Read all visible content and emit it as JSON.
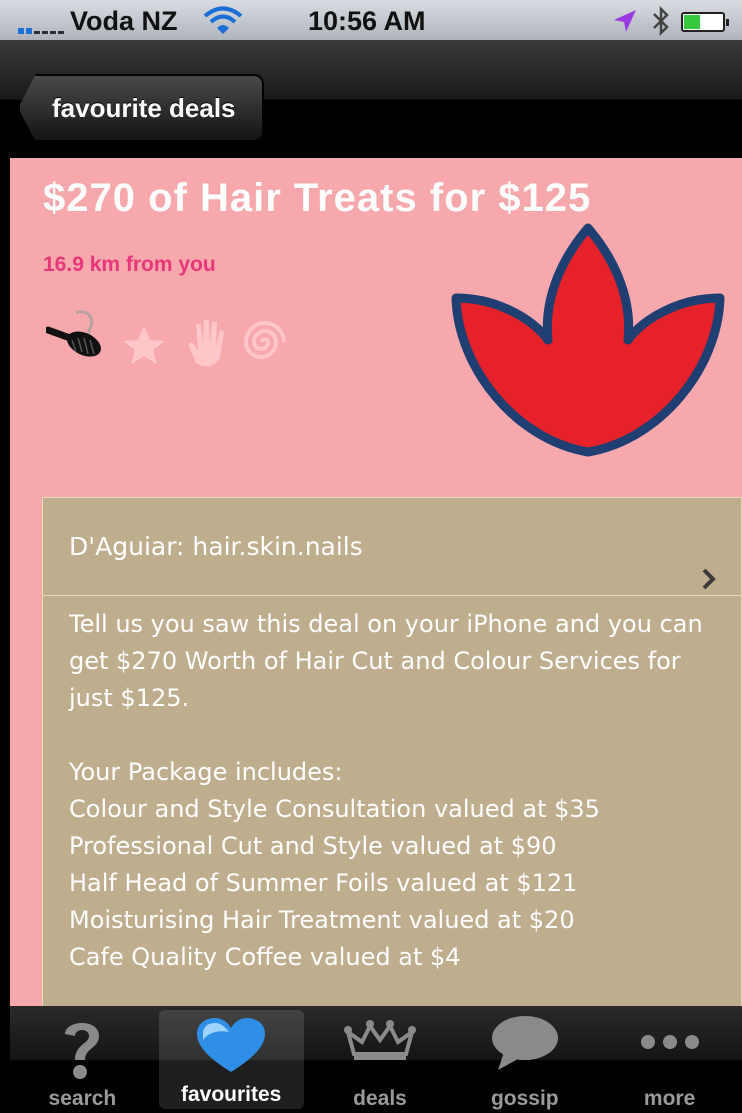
{
  "status_bar": {
    "carrier": "Voda NZ",
    "time": "10:56 AM"
  },
  "nav": {
    "back_label": "favourite deals"
  },
  "deal": {
    "title": "$270 of Hair Treats for $125",
    "distance": "16.9 km from you",
    "category_icons": [
      "brush-icon",
      "star-icon",
      "hand-icon",
      "spiral-icon"
    ],
    "logo": "lotus-logo",
    "merchant": "D'Aguiar: hair.skin.nails",
    "description": "Tell us you saw this deal on your iPhone and you can get $270 Worth of Hair Cut and Colour Services for just $125.",
    "package_heading": "Your Package includes:",
    "package_items": [
      "Colour and Style Consultation valued at $35",
      "Professional Cut and Style valued at $90",
      "Half Head of Summer Foils valued at $121",
      "Moisturising Hair Treatment valued at $20",
      "Cafe Quality Coffee valued at $4"
    ]
  },
  "tabs": [
    {
      "label": "search",
      "icon": "question-icon"
    },
    {
      "label": "favourites",
      "icon": "heart-icon",
      "active": true
    },
    {
      "label": "deals",
      "icon": "crown-icon"
    },
    {
      "label": "gossip",
      "icon": "speech-bubble-icon"
    },
    {
      "label": "more",
      "icon": "more-dots-icon"
    }
  ],
  "colors": {
    "background": "#f7a8ad",
    "distance": "#e8367a",
    "card": "#bfae8e",
    "logo_fill": "#e62129",
    "logo_stroke": "#1f3f73"
  }
}
